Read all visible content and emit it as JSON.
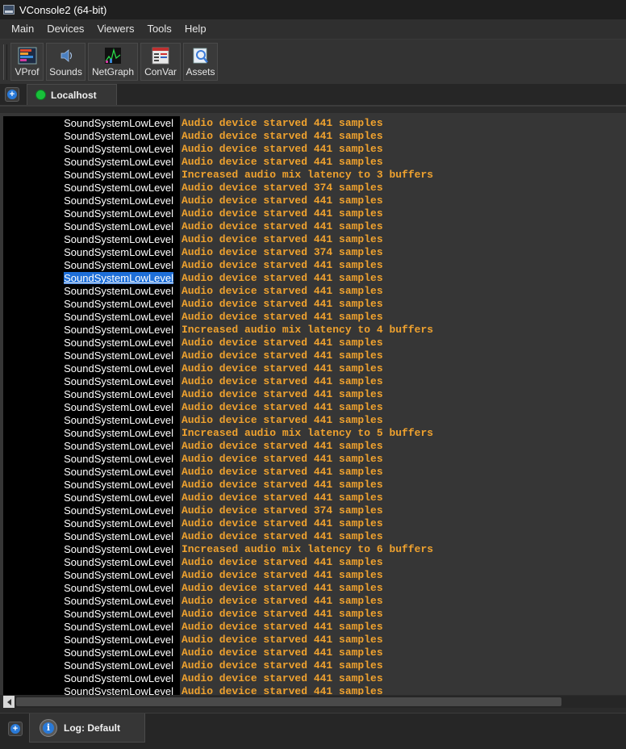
{
  "window": {
    "title": "VConsole2 (64-bit)"
  },
  "menu": [
    "Main",
    "Devices",
    "Viewers",
    "Tools",
    "Help"
  ],
  "toolbar": {
    "buttons": [
      {
        "label": "VProf",
        "icon": "vprof-icon"
      },
      {
        "label": "Sounds",
        "icon": "sounds-icon"
      },
      {
        "label": "NetGraph",
        "icon": "netgraph-icon"
      },
      {
        "label": "ConVar",
        "icon": "convar-icon"
      },
      {
        "label": "Assets",
        "icon": "assets-icon"
      }
    ]
  },
  "tabs": {
    "connection": "Localhost",
    "connection_status_color": "#18c03a"
  },
  "log": {
    "channel": "SoundSystemLowLevel",
    "selected_row": 12,
    "channel_bg": "#000000",
    "message_color": "#f0a22e",
    "rows": [
      "Audio device starved 441 samples",
      "Audio device starved 441 samples",
      "Audio device starved 441 samples",
      "Audio device starved 441 samples",
      "Increased audio mix latency to 3 buffers",
      "Audio device starved 374 samples",
      "Audio device starved 441 samples",
      "Audio device starved 441 samples",
      "Audio device starved 441 samples",
      "Audio device starved 441 samples",
      "Audio device starved 374 samples",
      "Audio device starved 441 samples",
      "Audio device starved 441 samples",
      "Audio device starved 441 samples",
      "Audio device starved 441 samples",
      "Audio device starved 441 samples",
      "Increased audio mix latency to 4 buffers",
      "Audio device starved 441 samples",
      "Audio device starved 441 samples",
      "Audio device starved 441 samples",
      "Audio device starved 441 samples",
      "Audio device starved 441 samples",
      "Audio device starved 441 samples",
      "Audio device starved 441 samples",
      "Increased audio mix latency to 5 buffers",
      "Audio device starved 441 samples",
      "Audio device starved 441 samples",
      "Audio device starved 441 samples",
      "Audio device starved 441 samples",
      "Audio device starved 441 samples",
      "Audio device starved 374 samples",
      "Audio device starved 441 samples",
      "Audio device starved 441 samples",
      "Increased audio mix latency to 6 buffers",
      "Audio device starved 441 samples",
      "Audio device starved 441 samples",
      "Audio device starved 441 samples",
      "Audio device starved 441 samples",
      "Audio device starved 441 samples",
      "Audio device starved 441 samples",
      "Audio device starved 441 samples",
      "Audio device starved 441 samples",
      "Audio device starved 441 samples",
      "Audio device starved 441 samples",
      "Audio device starved 441 samples"
    ]
  },
  "bottom": {
    "log_tab": "Log: Default"
  }
}
